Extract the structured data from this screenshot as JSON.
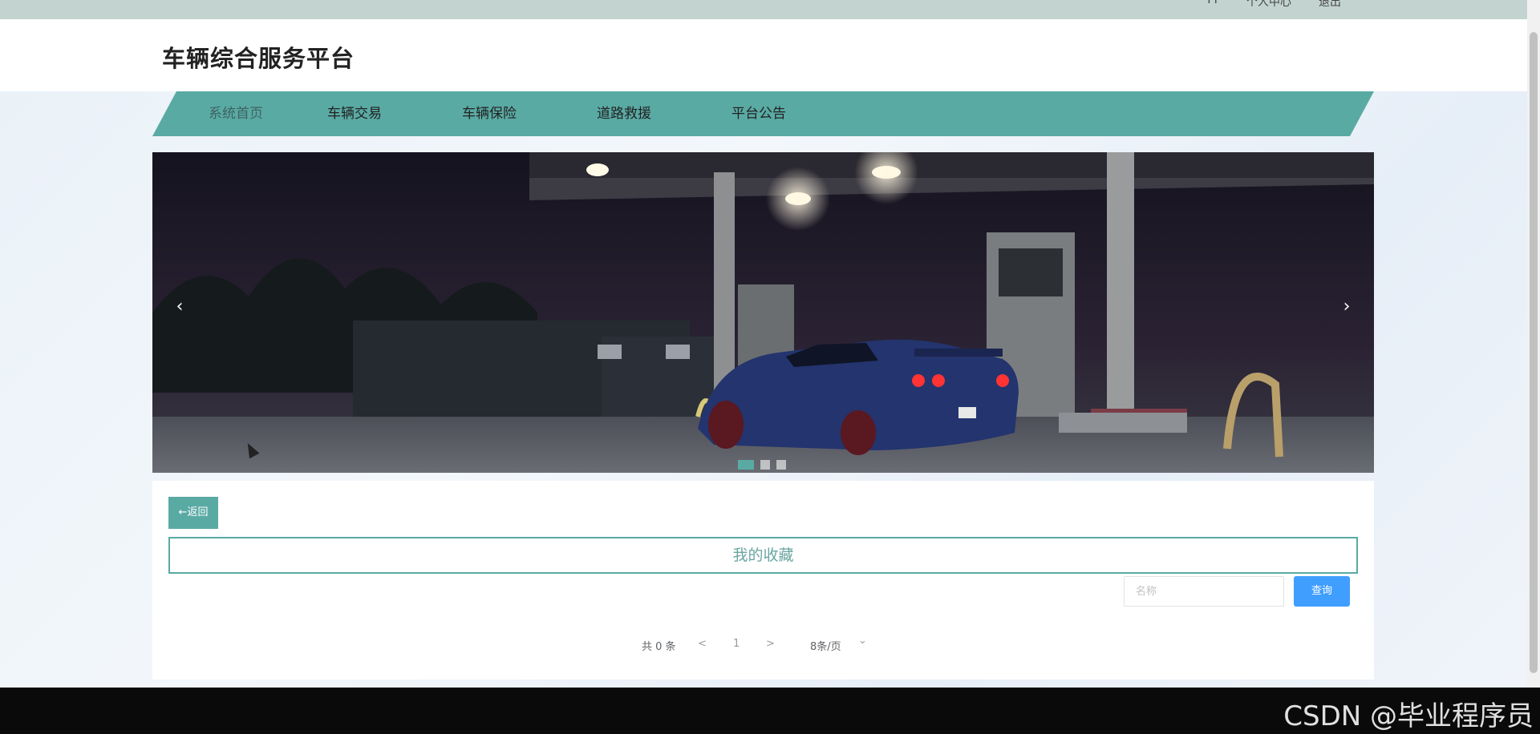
{
  "topbar": {
    "links": [
      "TT",
      "个人中心",
      "退出"
    ]
  },
  "header": {
    "title": "车辆综合服务平台"
  },
  "nav": {
    "items": [
      {
        "label": "系统首页",
        "active": true
      },
      {
        "label": "车辆交易",
        "active": false
      },
      {
        "label": "车辆保险",
        "active": false
      },
      {
        "label": "道路救援",
        "active": false
      },
      {
        "label": "平台公告",
        "active": false
      }
    ]
  },
  "banner": {
    "prev_icon": "chevron-left-icon",
    "next_icon": "chevron-right-icon",
    "prev_glyph": "‹",
    "next_glyph": "›",
    "slide_count": 3,
    "active_slide": 1
  },
  "content": {
    "back_label": "←返回",
    "section_title": "我的收藏",
    "search": {
      "placeholder": "名称",
      "value": ""
    },
    "query_label": "查询",
    "pagination": {
      "total_text": "共 0 条",
      "prev": "<",
      "page": "1",
      "next": ">",
      "page_size": "8条/页",
      "dropdown_icon": "⌄"
    }
  },
  "watermark": "CSDN @毕业程序员",
  "colors": {
    "accent": "#5aaaa4",
    "query_button": "#409eff",
    "topbar": "#c3d4d0"
  }
}
